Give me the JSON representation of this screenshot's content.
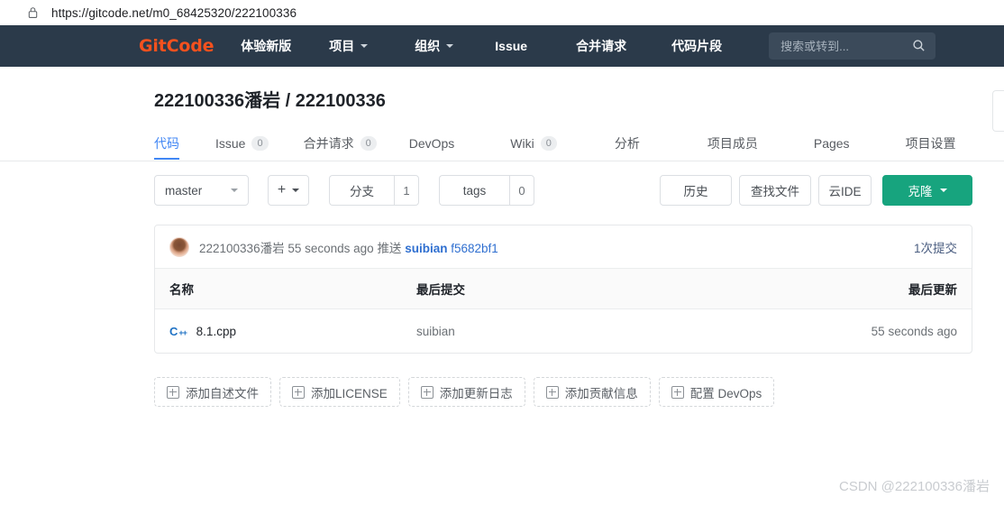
{
  "browser": {
    "url": "https://gitcode.net/m0_68425320/222100336",
    "lock_icon": "lock-icon"
  },
  "navbar": {
    "logo": "GitCode",
    "logo_color": "#f4511e",
    "background": "#2b3a4a",
    "items": [
      {
        "label": "体验新版",
        "has_caret": false
      },
      {
        "label": "项目",
        "has_caret": true
      },
      {
        "label": "组织",
        "has_caret": true
      },
      {
        "label": "Issue",
        "has_caret": false
      },
      {
        "label": "合并请求",
        "has_caret": false
      },
      {
        "label": "代码片段",
        "has_caret": false
      }
    ],
    "search": {
      "placeholder": "搜索或转到...",
      "value": "",
      "icon": "search-icon"
    }
  },
  "project": {
    "title": "222100336潘岩 / 222100336"
  },
  "tabs": [
    {
      "label": "代码",
      "count": null,
      "active": true
    },
    {
      "label": "Issue",
      "count": "0",
      "active": false
    },
    {
      "label": "合并请求",
      "count": "0",
      "active": false
    },
    {
      "label": "DevOps",
      "count": null,
      "active": false
    },
    {
      "label": "Wiki",
      "count": "0",
      "active": false
    },
    {
      "label": "分析",
      "count": null,
      "active": false
    },
    {
      "label": "项目成员",
      "count": null,
      "active": false
    },
    {
      "label": "Pages",
      "count": null,
      "active": false
    },
    {
      "label": "项目设置",
      "count": null,
      "active": false
    }
  ],
  "toolbar": {
    "branch": "master",
    "add_label": "+",
    "branch_label": "分支",
    "branch_count": "1",
    "tags_label": "tags",
    "tags_count": "0",
    "history": "历史",
    "find_file": "查找文件",
    "cloud_ide": "云IDE",
    "clone": "克隆",
    "clone_color": "#17a47e"
  },
  "commit_bar": {
    "author": "222100336潘岩",
    "time": "55 seconds ago",
    "action": "推送",
    "message": "suibian",
    "hash": "f5682bf1",
    "commit_count": "1次提交"
  },
  "file_table": {
    "headers": {
      "name": "名称",
      "last_commit": "最后提交",
      "last_update": "最后更新"
    },
    "rows": [
      {
        "icon": "cpp-file-icon",
        "name": "8.1.cpp",
        "last_commit": "suibian",
        "last_update": "55 seconds ago"
      }
    ]
  },
  "actions": [
    {
      "label": "添加自述文件"
    },
    {
      "label": "添加LICENSE"
    },
    {
      "label": "添加更新日志"
    },
    {
      "label": "添加贡献信息"
    },
    {
      "label": "配置 DevOps"
    }
  ],
  "watermark": "CSDN @222100336潘岩"
}
